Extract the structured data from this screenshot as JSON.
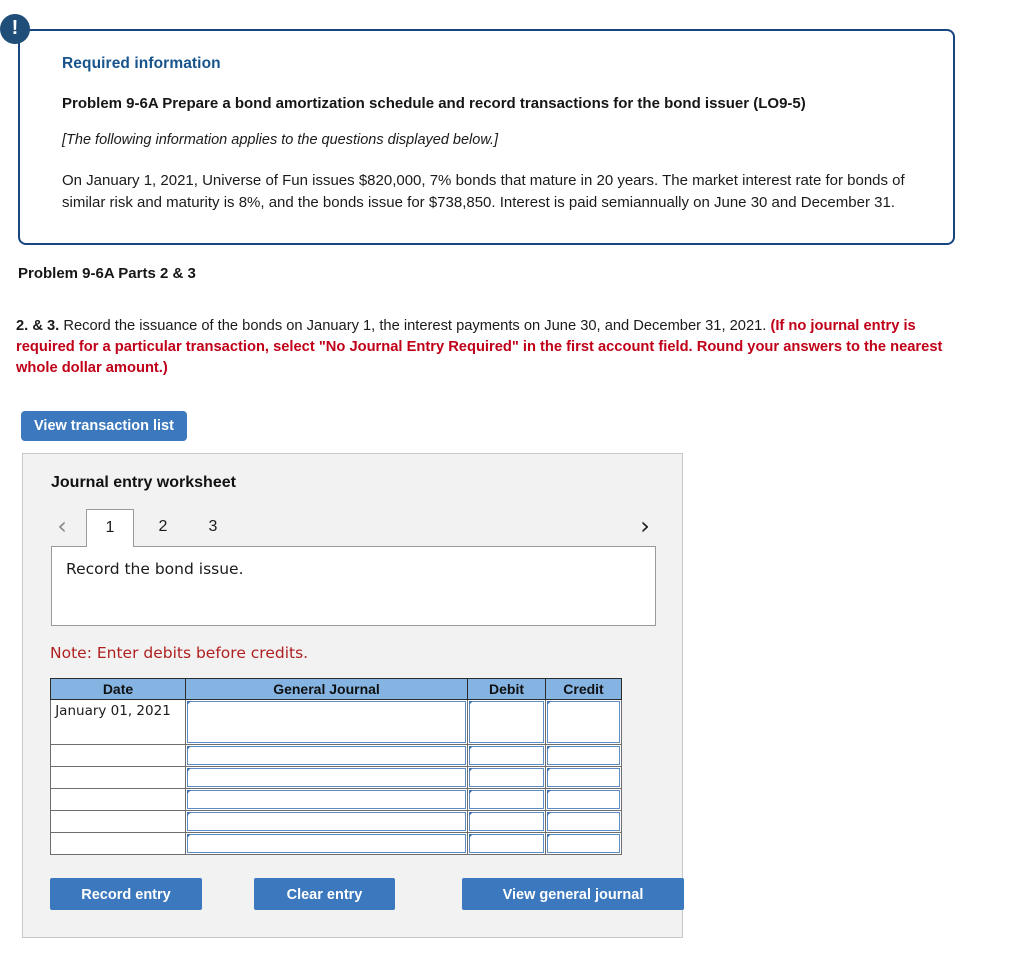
{
  "required_info": {
    "badge_icon": "exclamation-icon",
    "heading": "Required information",
    "problem_title": "Problem 9-6A Prepare a bond amortization schedule and record transactions for the bond issuer (LO9-5)",
    "applies_note": "[The following information applies to the questions displayed below.]",
    "body": "On January 1, 2021, Universe of Fun issues $820,000, 7% bonds that mature in 20 years. The market interest rate for bonds of similar risk and maturity is 8%, and the bonds issue for $738,850. Interest is paid semiannually on June 30 and December 31.",
    "border_color": "#17457e",
    "heading_color": "#17548c"
  },
  "part": {
    "title": "Problem 9-6A Parts 2 & 3"
  },
  "instructions": {
    "lead": "2. & 3.",
    "black_text": " Record the issuance of the bonds on January 1, the interest payments on June 30, and December 31, 2021. ",
    "red_text": "(If no journal entry is required for a particular transaction, select \"No Journal Entry Required\" in the first account field. Round your answers to the nearest whole dollar amount.)",
    "red_color": "#c00018"
  },
  "toolbar": {
    "view_transaction_list_label": "View transaction list",
    "button_color": "#3b78bd"
  },
  "worksheet": {
    "title": "Journal entry worksheet",
    "tabs": {
      "prev_icon": "chevron-left-icon",
      "next_icon": "chevron-right-icon",
      "items": [
        {
          "label": "1",
          "active": true
        },
        {
          "label": "2",
          "active": false
        },
        {
          "label": "3",
          "active": false
        }
      ]
    },
    "transaction_description": "Record the bond issue.",
    "note": "Note: Enter debits before credits.",
    "note_color": "#b02020",
    "table": {
      "header_color": "#85b4e3",
      "columns": [
        "Date",
        "General Journal",
        "Debit",
        "Credit"
      ],
      "rows": [
        {
          "date": "January 01, 2021",
          "general_journal": "",
          "debit": "",
          "credit": ""
        },
        {
          "date": "",
          "general_journal": "",
          "debit": "",
          "credit": ""
        },
        {
          "date": "",
          "general_journal": "",
          "debit": "",
          "credit": ""
        },
        {
          "date": "",
          "general_journal": "",
          "debit": "",
          "credit": ""
        },
        {
          "date": "",
          "general_journal": "",
          "debit": "",
          "credit": ""
        },
        {
          "date": "",
          "general_journal": "",
          "debit": "",
          "credit": ""
        }
      ]
    },
    "footer": {
      "record_entry_label": "Record entry",
      "clear_entry_label": "Clear entry",
      "view_general_journal_label": "View general journal"
    }
  }
}
